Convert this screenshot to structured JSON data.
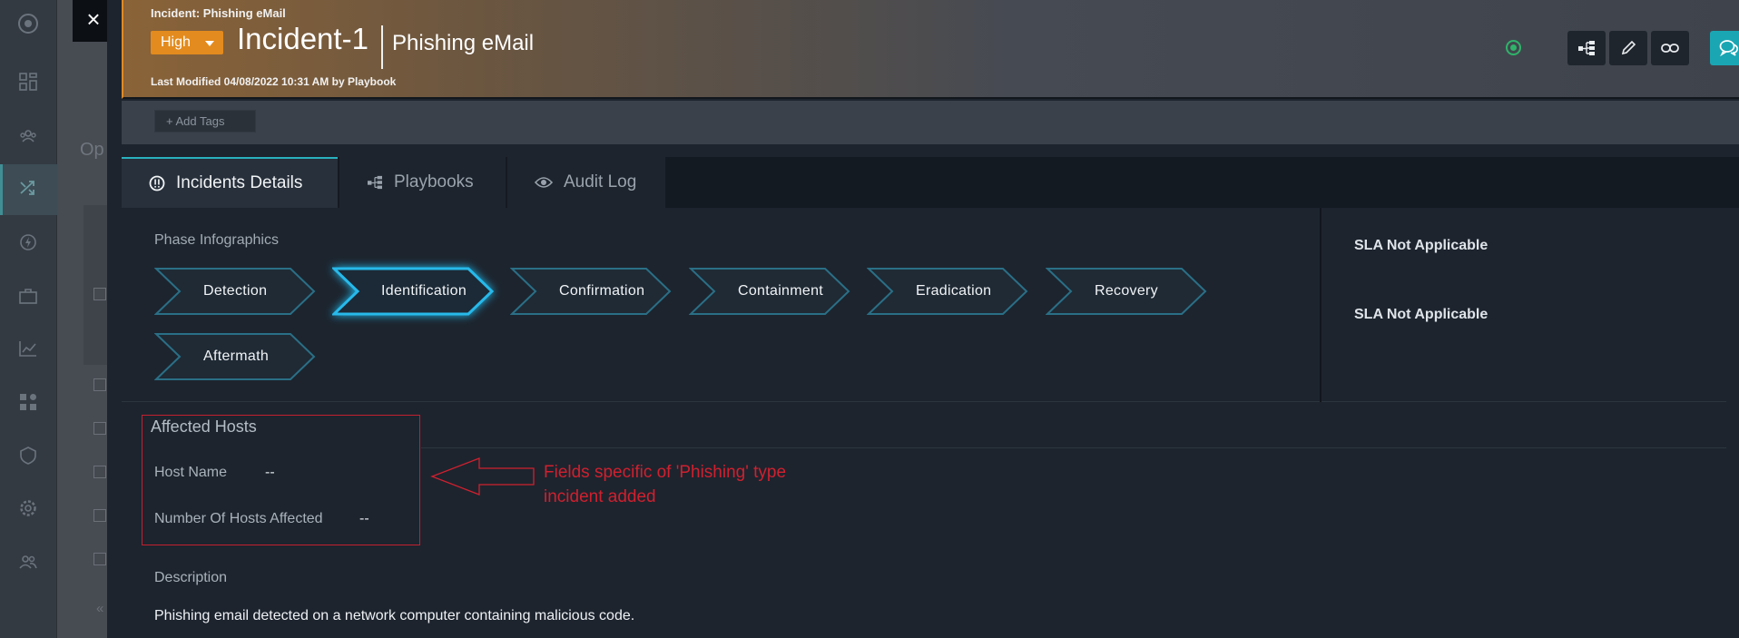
{
  "background_app": {
    "panel_title": "Op",
    "row_number": "5"
  },
  "header": {
    "label": "Incident: Phishing eMail",
    "severity": "High",
    "incident_id": "Incident-1",
    "incident_name": "Phishing eMail",
    "last_modified": "Last Modified 04/08/2022 10:31 AM by Playbook"
  },
  "tags": {
    "add_label": "+ Add Tags"
  },
  "tabs": [
    {
      "label": "Incidents Details",
      "active": true
    },
    {
      "label": "Playbooks",
      "active": false
    },
    {
      "label": "Audit Log",
      "active": false
    }
  ],
  "phase": {
    "title": "Phase Infographics",
    "items": [
      {
        "label": "Detection",
        "active": false
      },
      {
        "label": "Identification",
        "active": true
      },
      {
        "label": "Confirmation",
        "active": false
      },
      {
        "label": "Containment",
        "active": false
      },
      {
        "label": "Eradication",
        "active": false
      },
      {
        "label": "Recovery",
        "active": false
      },
      {
        "label": "Aftermath",
        "active": false
      }
    ]
  },
  "sla": [
    "SLA Not Applicable",
    "SLA Not Applicable"
  ],
  "affected_hosts": {
    "title": "Affected Hosts",
    "host_name_label": "Host Name",
    "host_name_value": "--",
    "hosts_count_label": "Number Of Hosts Affected",
    "hosts_count_value": "--"
  },
  "annotation": {
    "text": "Fields specific of 'Phishing' type incident added"
  },
  "description": {
    "label": "Description",
    "text": "Phishing email detected on a network computer containing malicious code."
  },
  "colors": {
    "severity": "#e38b1e",
    "accent": "#29b1bd",
    "annotation": "#d0202e",
    "status": "#2fb36a"
  }
}
